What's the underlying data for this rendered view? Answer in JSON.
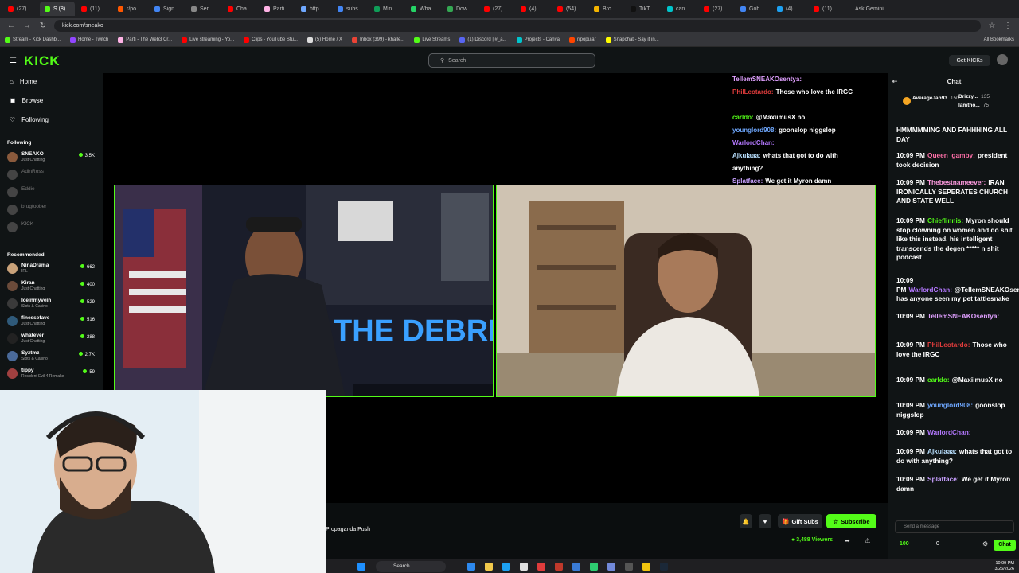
{
  "browser": {
    "tabs": [
      "(27)",
      "S (8)",
      "(11)",
      "r/po",
      "Sign",
      "Sen",
      "Cha",
      "Parti",
      "http",
      "subs",
      "Min",
      "Wha",
      "Dow",
      "(27)",
      "(4)",
      "(54)",
      "Bro",
      "TikT",
      "can",
      "(27)",
      "Gob",
      "(4)",
      "(11)"
    ],
    "ask_gemini": "Ask Gemini",
    "url": "kick.com/sneako",
    "bookmarks": [
      "Stream - Kick Dashb...",
      "Home - Twitch",
      "Parti - The Web3 Cr...",
      "Live streaming - Yo...",
      "Clips - YouTube Stu...",
      "(5) Home / X",
      "Inbox (399) - khalle...",
      "Live Streams",
      "(1) Discord | #_a...",
      "Projects - Canva",
      "r/popular",
      "Snapchat - Say it in..."
    ],
    "all_bookmarks": "All Bookmarks"
  },
  "header": {
    "logo": "KICK",
    "search_placeholder": "Search",
    "get_kicks": "Get KICKs"
  },
  "sidebar": {
    "nav": [
      {
        "label": "Home",
        "icon": "home-icon"
      },
      {
        "label": "Browse",
        "icon": "browse-icon"
      },
      {
        "label": "Following",
        "icon": "heart-icon"
      }
    ],
    "following_title": "Following",
    "following": [
      {
        "name": "SNEAKO",
        "category": "Just Chatting",
        "viewers": "3.5K",
        "live": true,
        "color": "#8a5a3c"
      },
      {
        "name": "AdinRoss",
        "category": "",
        "viewers": "",
        "live": false,
        "color": "#444"
      },
      {
        "name": "Eddie",
        "category": "",
        "viewers": "",
        "live": false,
        "color": "#444"
      },
      {
        "name": "brugtoober",
        "category": "",
        "viewers": "",
        "live": false,
        "color": "#444"
      },
      {
        "name": "KICK",
        "category": "",
        "viewers": "",
        "live": false,
        "color": "#444"
      }
    ],
    "recommended_title": "Recommended",
    "recommended": [
      {
        "name": "NinaDrama",
        "category": "IRL",
        "viewers": "662",
        "color": "#c9a27a"
      },
      {
        "name": "Kiran",
        "category": "Just Chatting",
        "viewers": "400",
        "color": "#6b4b3a"
      },
      {
        "name": "Iceinmyvein",
        "category": "Slots & Casino",
        "viewers": "529",
        "color": "#3a3a3a"
      },
      {
        "name": "finessefave",
        "category": "Just Chatting",
        "viewers": "516",
        "color": "#2f5a7a"
      },
      {
        "name": "whatever",
        "category": "Just Chatting",
        "viewers": "288",
        "color": "#222"
      },
      {
        "name": "Syztmz",
        "category": "Slots & Casino",
        "viewers": "2.7K",
        "color": "#4a6a9a"
      },
      {
        "name": "tippy",
        "category": "Resident Evil 4 Remake",
        "viewers": "59",
        "color": "#a04040"
      }
    ]
  },
  "overlay_chat": [
    {
      "user": "TellemSNEAKOsentya:",
      "text": "",
      "color": "#e0a0ff"
    },
    {
      "user": "PhilLeotardo:",
      "text": "Those who love the IRGC",
      "color": "#e03c3c"
    },
    {
      "user": "",
      "text": "",
      "color": "#fff"
    },
    {
      "user": "carldo:",
      "text": "@MaxiimusX no",
      "color": "#53fc18"
    },
    {
      "user": "younglord908:",
      "text": "goonslop niggslop",
      "color": "#6fa8ff"
    },
    {
      "user": "WarlordChan:",
      "text": "",
      "color": "#b478ff"
    },
    {
      "user": "Ajkulaaa:",
      "text": "whats that got to do with",
      "color": "#b9e0ff"
    },
    {
      "user": "",
      "text": "anything?",
      "color": "#fff"
    },
    {
      "user": "Splatface:",
      "text": "We get it Myron damn",
      "color": "#c8a0ff"
    }
  ],
  "stream": {
    "title": "Propaganda Push",
    "viewers": "3,488 Viewers",
    "gift_subs": "Gift Subs",
    "subscribe": "Subscribe",
    "debrief_text": "THE DEBRIEF"
  },
  "chat": {
    "title": "Chat",
    "pinned": [
      {
        "name": "AverageJan93",
        "count": "150"
      },
      {
        "name": "Drizzy...",
        "count": "135"
      },
      {
        "name": "lamtho...",
        "count": "75"
      }
    ],
    "messages": [
      {
        "time": "",
        "user": "",
        "text": "HMMMMMING AND FAHHHING ALL DAY",
        "color": "#fff"
      },
      {
        "time": "10:09 PM",
        "user": "Queen_gamby:",
        "text": "president took decision",
        "color": "#ff6fa8"
      },
      {
        "time": "10:09 PM",
        "user": "Thebestnameever:",
        "text": "IRAN IRONICALLY SEPERATES CHURCH AND STATE WELL",
        "color": "#ff9be0"
      },
      {
        "time": "10:09 PM",
        "user": "Chieflinnis:",
        "text": "Myron should stop clowning on women and do shit like this instead. his intelligent transcends the degen ***** n shit podcast",
        "color": "#53fc18"
      },
      {
        "time": "10:09 PM",
        "user": "WarlordChan:",
        "text": "@TellemSNEAKOsentya has anyone seen my pet tattlesnake",
        "color": "#b478ff"
      },
      {
        "time": "10:09 PM",
        "user": "TellemSNEAKOsentya:",
        "text": "",
        "color": "#e0a0ff"
      },
      {
        "time": "10:09 PM",
        "user": "PhilLeotardo:",
        "text": "Those who love the IRGC",
        "color": "#e03c3c"
      },
      {
        "time": "10:09 PM",
        "user": "carldo:",
        "text": "@MaxiimusX no",
        "color": "#53fc18"
      },
      {
        "time": "10:09 PM",
        "user": "younglord908:",
        "text": "goonslop niggslop",
        "color": "#6fa8ff"
      },
      {
        "time": "10:09 PM",
        "user": "WarlordChan:",
        "text": "",
        "color": "#b478ff"
      },
      {
        "time": "10:09 PM",
        "user": "Ajkulaaa:",
        "text": "whats that got to do with anything?",
        "color": "#b9e0ff"
      },
      {
        "time": "10:09 PM",
        "user": "Splatface:",
        "text": "We get it Myron damn",
        "color": "#c8a0ff"
      }
    ],
    "input_placeholder": "Send a message",
    "points": "100",
    "zero": "0",
    "send_label": "Chat"
  },
  "taskbar": {
    "search": "Search",
    "time": "10:09 PM",
    "date": "3/26/2026"
  }
}
